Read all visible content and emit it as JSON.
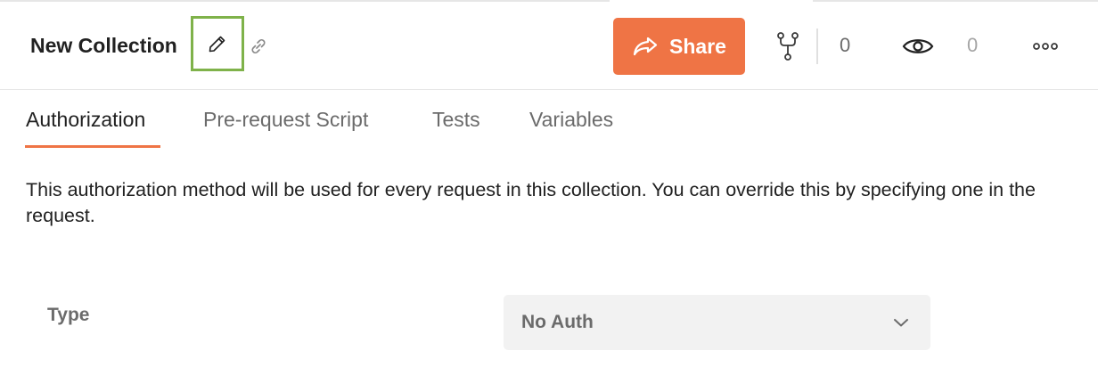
{
  "header": {
    "title": "New Collection",
    "share_label": "Share",
    "fork_count": "0",
    "watch_count": "0",
    "icons": {
      "edit": "pencil-icon",
      "link": "link-icon",
      "share": "share-arrow-icon",
      "fork": "fork-icon",
      "watch": "eye-icon",
      "more": "more-horizontal-icon"
    }
  },
  "tabs": [
    {
      "label": "Authorization",
      "active": true
    },
    {
      "label": "Pre-request Script",
      "active": false
    },
    {
      "label": "Tests",
      "active": false
    },
    {
      "label": "Variables",
      "active": false
    }
  ],
  "description": "This authorization method will be used for every request in this collection. You can override this by specifying one in the request.",
  "type_field": {
    "label": "Type",
    "selected_value": "No Auth"
  },
  "colors": {
    "accent": "#ef7445",
    "highlight_box": "#7fb24a",
    "text_primary": "#212121",
    "text_secondary": "#6b6b6b",
    "select_bg": "#f2f2f2"
  }
}
